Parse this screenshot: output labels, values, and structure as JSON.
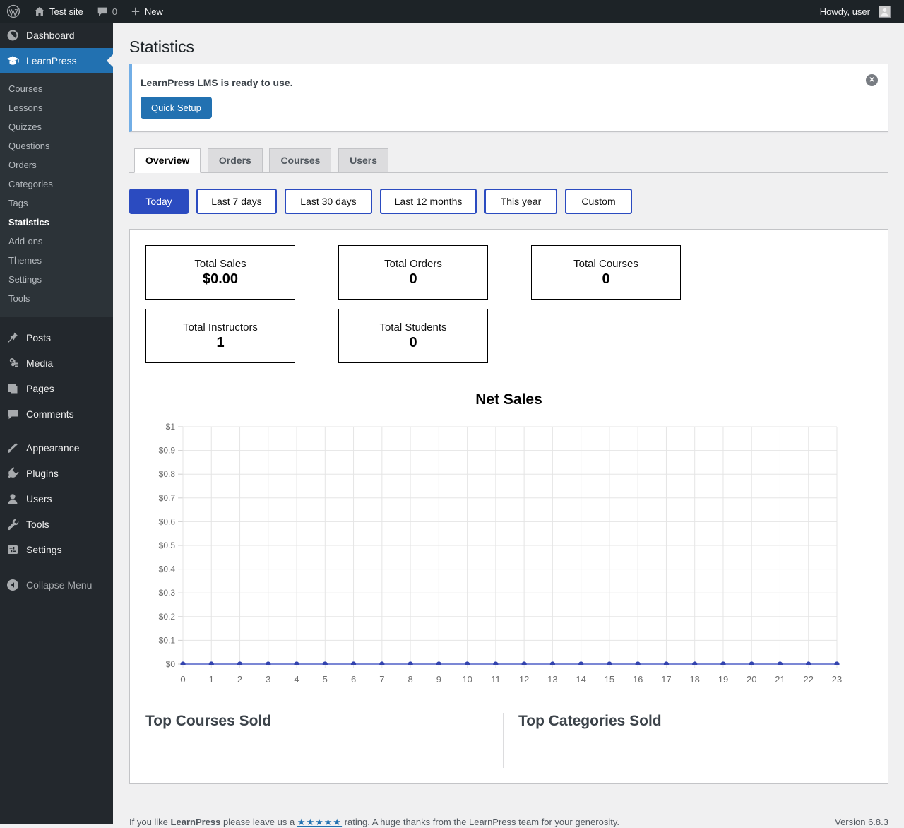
{
  "admin_bar": {
    "site_name": "Test site",
    "comment_count": "0",
    "new_label": "New",
    "howdy": "Howdy, user"
  },
  "sidebar": {
    "dashboard_label": "Dashboard",
    "learnpress_label": "LearnPress",
    "submenu": [
      "Courses",
      "Lessons",
      "Quizzes",
      "Questions",
      "Orders",
      "Categories",
      "Tags",
      "Statistics",
      "Add-ons",
      "Themes",
      "Settings",
      "Tools"
    ],
    "current_submenu": "Statistics",
    "menu_lower": [
      "Posts",
      "Media",
      "Pages",
      "Comments"
    ],
    "menu_lower2": [
      "Appearance",
      "Plugins",
      "Users",
      "Tools",
      "Settings"
    ],
    "collapse_label": "Collapse Menu"
  },
  "page": {
    "title": "Statistics"
  },
  "notice": {
    "message": "LearnPress LMS is ready to use.",
    "button_label": "Quick Setup"
  },
  "tabs": [
    "Overview",
    "Orders",
    "Courses",
    "Users"
  ],
  "active_tab": "Overview",
  "filters": [
    "Today",
    "Last 7 days",
    "Last 30 days",
    "Last 12 months",
    "This year",
    "Custom"
  ],
  "active_filter": "Today",
  "stats": [
    {
      "label": "Total Sales",
      "value": "$0.00"
    },
    {
      "label": "Total Orders",
      "value": "0"
    },
    {
      "label": "Total Courses",
      "value": "0"
    },
    {
      "label": "Total Instructors",
      "value": "1"
    },
    {
      "label": "Total Students",
      "value": "0"
    }
  ],
  "chart_data": {
    "type": "line",
    "title": "Net Sales",
    "x_labels": [
      "0",
      "1",
      "2",
      "3",
      "4",
      "5",
      "6",
      "7",
      "8",
      "9",
      "10",
      "11",
      "12",
      "13",
      "14",
      "15",
      "16",
      "17",
      "18",
      "19",
      "20",
      "21",
      "22",
      "23"
    ],
    "series": [
      {
        "name": "Net Sales",
        "values": [
          0,
          0,
          0,
          0,
          0,
          0,
          0,
          0,
          0,
          0,
          0,
          0,
          0,
          0,
          0,
          0,
          0,
          0,
          0,
          0,
          0,
          0,
          0,
          0
        ]
      }
    ],
    "ylim": [
      0,
      1
    ],
    "ytick_labels": [
      "$1",
      "$0.9",
      "$0.8",
      "$0.7",
      "$0.6",
      "$0.5",
      "$0.4",
      "$0.3",
      "$0.2",
      "$0.1",
      "$0"
    ],
    "grid": true,
    "legend": "none",
    "line_color": "#6e7bd1",
    "point_color": "#3243ae",
    "grid_color": "#e5e5e5",
    "tick_color": "#cfcfcf",
    "label_color": "#6e6e6e"
  },
  "sections": {
    "top_courses": "Top Courses Sold",
    "top_categories": "Top Categories Sold"
  },
  "footer": {
    "text_prefix": "If you like",
    "brand": "LearnPress",
    "text_mid": "please leave us a",
    "stars": "★★★★★",
    "text_suffix": "rating. A huge thanks from the LearnPress team for your generosity.",
    "version": "Version 6.8.3"
  },
  "colors": {
    "filter_accent": "#2b4bc0",
    "wp_blue": "#2271b1",
    "notice_border": "#72aee6"
  }
}
